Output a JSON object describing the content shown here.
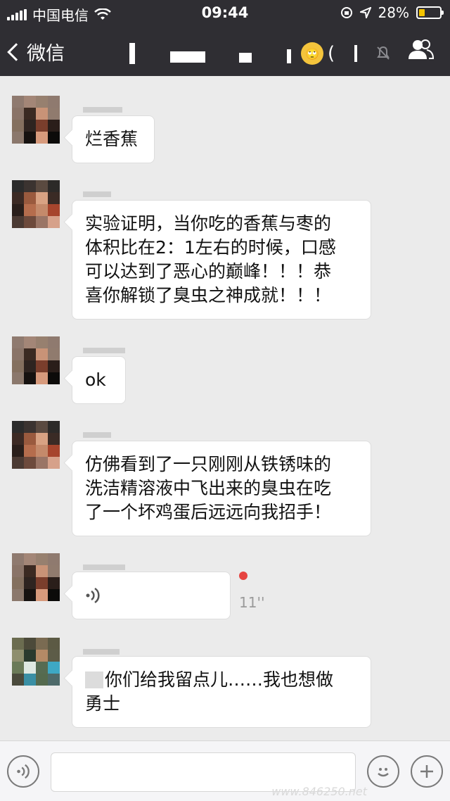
{
  "status_bar": {
    "carrier": "中国电信",
    "time": "09:44",
    "battery_percent": "28%",
    "battery_level": 0.28
  },
  "nav": {
    "back_label": "微信",
    "title_emoji": "🙄",
    "title_suffix": "("
  },
  "messages": [
    {
      "type": "text",
      "text": "烂香蕉"
    },
    {
      "type": "text",
      "lines": [
        "实验证明，当你吃的香蕉与枣的",
        "体积比在2：1左右的时候，口感",
        "可以达到了恶心的巅峰！！！恭",
        "喜你解锁了臭虫之神成就！！！"
      ]
    },
    {
      "type": "text",
      "text": "ok"
    },
    {
      "type": "text",
      "lines": [
        "仿佛看到了一只刚刚从铁锈味的",
        "洗洁精溶液中飞出来的臭虫在吃",
        "了一个坏鸡蛋后远远向我招手！"
      ]
    },
    {
      "type": "voice",
      "duration": "11''",
      "unread": true
    },
    {
      "type": "text",
      "lines": [
        "你们给我留点儿……我也想做",
        "勇士"
      ]
    }
  ],
  "input_bar": {
    "voice_icon": "voice-icon",
    "emoji_icon": "emoji-icon",
    "add_icon": "plus-icon",
    "watermark": "www.846250.net"
  },
  "colors": {
    "nav_bg": "#2f2e33",
    "chat_bg": "#ebebeb",
    "bubble_bg": "#ffffff",
    "unread_dot": "#e64340",
    "battery_fill": "#f5c400"
  }
}
